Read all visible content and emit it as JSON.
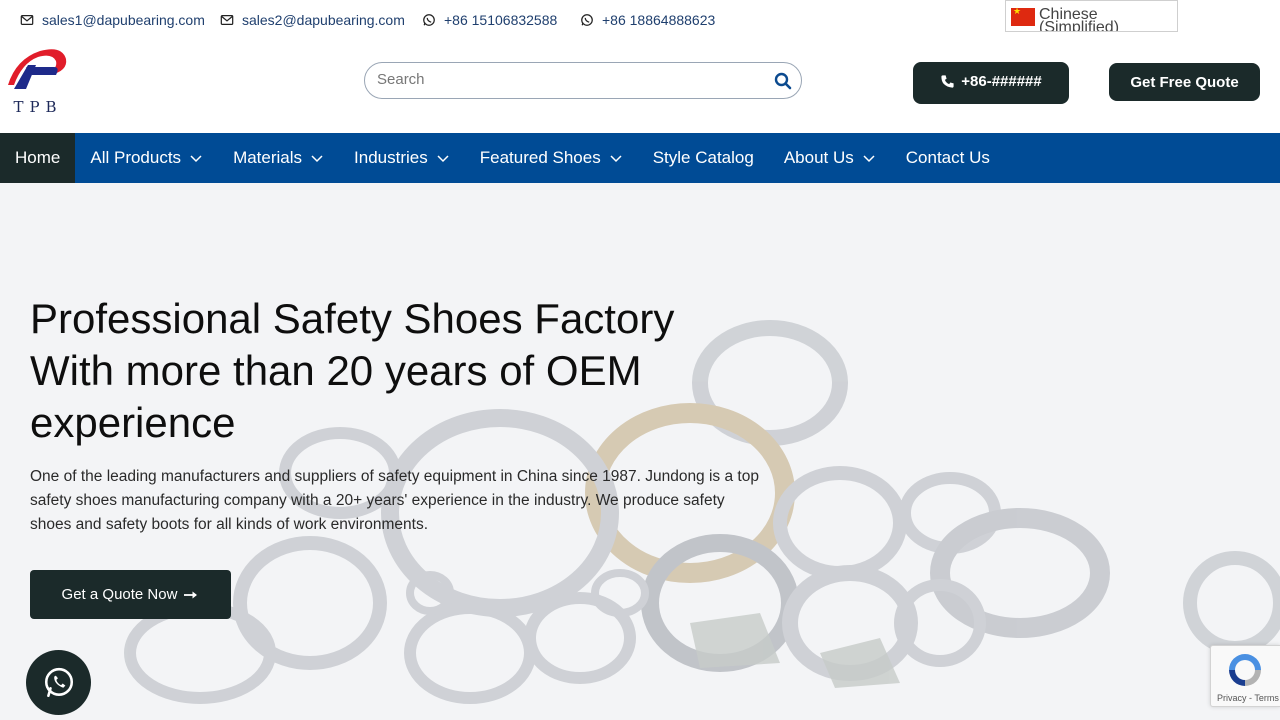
{
  "topbar": {
    "email1": "sales1@dapubearing.com",
    "email2": "sales2@dapubearing.com",
    "phone1": "+86 15106832588",
    "phone2": "+86 18864888623",
    "language": "Chinese (Simplified)"
  },
  "header": {
    "logo_text": "TPB",
    "search_placeholder": "Search",
    "phone_button": "+86-######",
    "quote_button": "Get Free Quote"
  },
  "nav": {
    "items": [
      {
        "label": "Home"
      },
      {
        "label": "All Products"
      },
      {
        "label": "Materials"
      },
      {
        "label": "Industries"
      },
      {
        "label": "Featured Shoes"
      },
      {
        "label": "Style Catalog"
      },
      {
        "label": "About Us"
      },
      {
        "label": "Contact Us"
      }
    ]
  },
  "hero": {
    "title_line1": "Professional Safety Shoes Factory",
    "title_line2": "With more than 20 years of OEM",
    "title_line3": "experience",
    "description": "One of the leading manufacturers and suppliers of safety equipment in China since 1987. Jundong is a top safety shoes manufacturing company with a 20+ years' experience in the industry. We produce safety shoes and safety boots for all kinds of work environments.",
    "cta_label": "Get a Quote Now"
  },
  "recaptcha": {
    "links": "Privacy - Terms"
  },
  "colors": {
    "nav_blue": "#004b95",
    "dark": "#1b2a2a",
    "contact_text": "#1f3f6e"
  }
}
